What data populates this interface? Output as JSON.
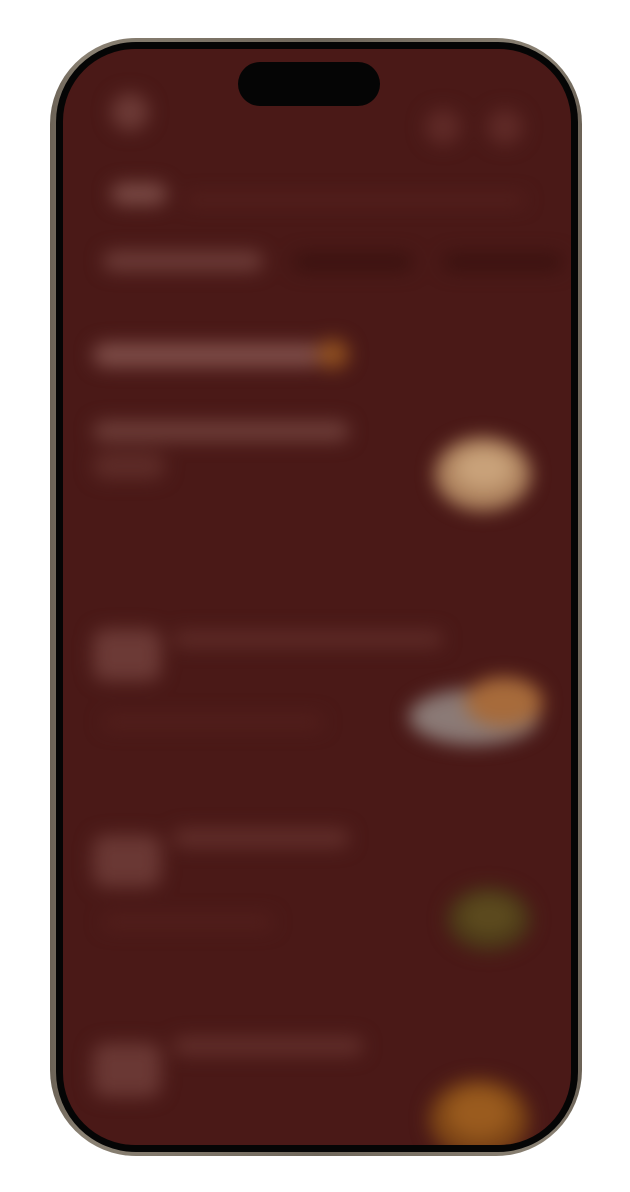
{
  "app": {
    "screen_background": "#4a1917",
    "content_state": "blurred",
    "header": {
      "icons": [
        "profile-icon",
        "search-icon",
        "cart-icon"
      ]
    },
    "sections": [
      {
        "kind": "title-row"
      },
      {
        "kind": "filter-row"
      },
      {
        "kind": "section-heading",
        "accent": "#c27a2e"
      },
      {
        "kind": "food-card",
        "thumbnail": "bread"
      },
      {
        "kind": "food-card",
        "thumbnail": "plate"
      },
      {
        "kind": "food-card",
        "thumbnail": "greens"
      },
      {
        "kind": "food-card",
        "thumbnail": "fried"
      }
    ]
  }
}
